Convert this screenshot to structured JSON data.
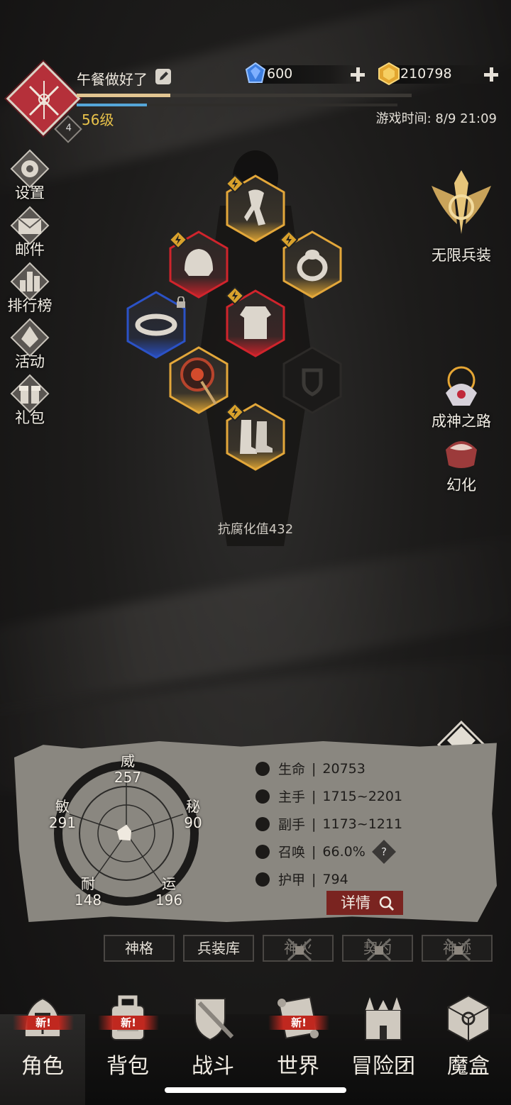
{
  "player": {
    "name": "午餐做好了",
    "level": "56级",
    "rank_badge": "4",
    "exp_fraction": 0.28,
    "stamina_fraction": 0.22
  },
  "currency": {
    "gems": "600",
    "gold": "210798"
  },
  "game_time": "游戏时间: 8/9 21:09",
  "left_menu": [
    {
      "label": "设置",
      "icon": "gear-icon"
    },
    {
      "label": "邮件",
      "icon": "mail-icon"
    },
    {
      "label": "排行榜",
      "icon": "ranking-icon"
    },
    {
      "label": "活动",
      "icon": "event-icon"
    },
    {
      "label": "礼包",
      "icon": "gift-icon"
    }
  ],
  "right_features": {
    "infinite_arms": "无限兵装",
    "path_to_godhood": "成神之路",
    "transform": "幻化"
  },
  "equipment": {
    "resist_corruption": "抗腐化值432",
    "slots": [
      "scarf",
      "helmet",
      "ring",
      "bracelet",
      "armor",
      "weapon",
      "shield-empty",
      "boots"
    ]
  },
  "attributes": {
    "wei": {
      "name": "威",
      "value": "257"
    },
    "mi": {
      "name": "秘",
      "value": "90"
    },
    "yun": {
      "name": "运",
      "value": "196"
    },
    "nai": {
      "name": "耐",
      "value": "148"
    },
    "min": {
      "name": "敏",
      "value": "291"
    }
  },
  "stats": [
    {
      "label": "生命",
      "value": "20753"
    },
    {
      "label": "主手",
      "value": "1715~2201"
    },
    {
      "label": "副手",
      "value": "1173~1211"
    },
    {
      "label": "召唤",
      "value": "66.0%"
    },
    {
      "label": "护甲",
      "value": "794"
    }
  ],
  "details_button": "详情",
  "help_mark": "?",
  "sub_tabs": [
    {
      "label": "神格",
      "locked": false
    },
    {
      "label": "兵装库",
      "locked": false
    },
    {
      "label": "神火",
      "locked": true
    },
    {
      "label": "契约",
      "locked": true
    },
    {
      "label": "神迹",
      "locked": true
    }
  ],
  "bottom_nav": [
    {
      "label": "角色",
      "new": true,
      "active": true
    },
    {
      "label": "背包",
      "new": true,
      "active": false
    },
    {
      "label": "战斗",
      "new": false,
      "active": false
    },
    {
      "label": "世界",
      "new": true,
      "active": false
    },
    {
      "label": "冒险团",
      "new": false,
      "active": false
    },
    {
      "label": "魔盒",
      "new": false,
      "active": false
    }
  ],
  "new_badge_text": "新!",
  "colors": {
    "accent_gold": "#e8c24a",
    "exp_bar": "#e2c591",
    "stamina_bar": "#55a6d8",
    "badge_red": "#c0281f"
  }
}
